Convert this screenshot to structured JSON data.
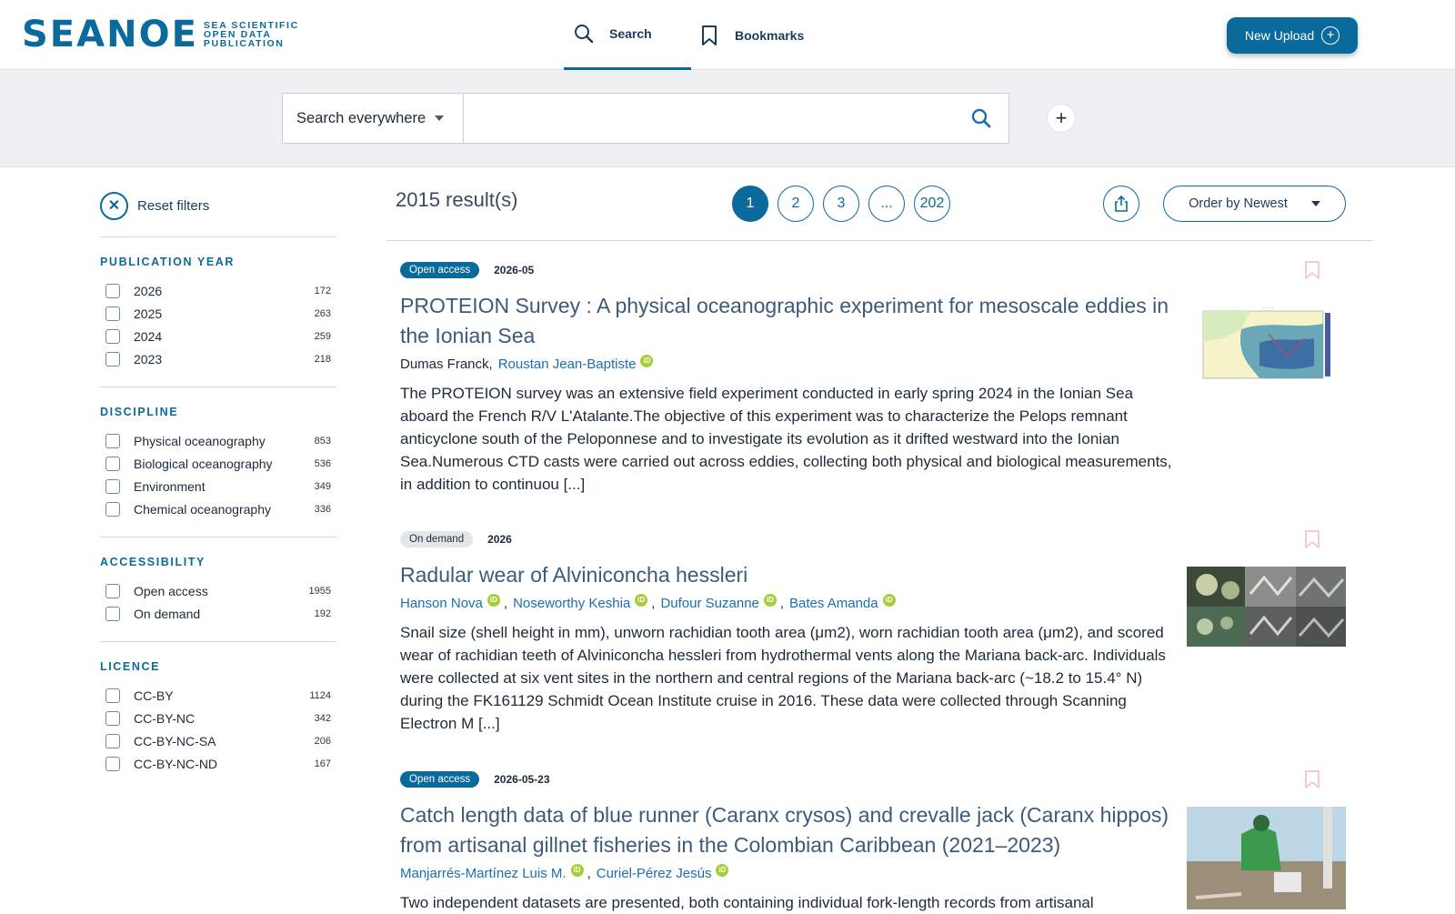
{
  "header": {
    "logo": {
      "word": "SEANOE",
      "sub1": "SEA SCIENTIFIC",
      "sub2": "OPEN DATA",
      "sub3": "PUBLICATION"
    },
    "nav": {
      "search": "Search",
      "bookmarks": "Bookmarks"
    },
    "upload": "New Upload"
  },
  "search": {
    "scope": "Search everywhere",
    "query": "",
    "add": "+"
  },
  "sidebar": {
    "reset": "Reset filters",
    "facets": [
      {
        "title": "PUBLICATION YEAR",
        "items": [
          {
            "label": "2026",
            "count": "172"
          },
          {
            "label": "2025",
            "count": "263"
          },
          {
            "label": "2024",
            "count": "259"
          },
          {
            "label": "2023",
            "count": "218"
          }
        ]
      },
      {
        "title": "DISCIPLINE",
        "items": [
          {
            "label": "Physical oceanography",
            "count": "853"
          },
          {
            "label": "Biological oceanography",
            "count": "536"
          },
          {
            "label": "Environment",
            "count": "349"
          },
          {
            "label": "Chemical oceanography",
            "count": "336"
          }
        ]
      },
      {
        "title": "ACCESSIBILITY",
        "items": [
          {
            "label": "Open access",
            "count": "1955"
          },
          {
            "label": "On demand",
            "count": "192"
          }
        ]
      },
      {
        "title": "LICENCE",
        "items": [
          {
            "label": "CC-BY",
            "count": "1124"
          },
          {
            "label": "CC-BY-NC",
            "count": "342"
          },
          {
            "label": "CC-BY-NC-SA",
            "count": "206"
          },
          {
            "label": "CC-BY-NC-ND",
            "count": "167"
          }
        ]
      }
    ]
  },
  "results": {
    "count": "2015 result(s)",
    "pages": [
      "1",
      "2",
      "3",
      "...",
      "202"
    ],
    "order": "Order by Newest",
    "items": [
      {
        "badge": "Open access",
        "date": "2026-05",
        "title": "PROTEION Survey : A physical oceanographic experiment for mesoscale eddies in the Ionian Sea",
        "author_plain": "Dumas  Franck",
        "author_links": [
          "Roustan Jean-Baptiste"
        ],
        "abstract": "The PROTEION survey was an extensive field experiment conducted in early spring 2024 in the Ionian Sea aboard the French R/V L'Atalante.The objective of this experiment was to characterize the Pelops remnant anticyclone south of the Peloponnese and to investigate its evolution as it drifted westward into the Ionian Sea.Numerous CTD casts were carried out across eddies, collecting both physical and biological measurements, in addition to continuou [...]"
      },
      {
        "badge": "On demand",
        "date": "2026",
        "title": "Radular wear of Alviniconcha hessleri",
        "author_links": [
          "Hanson Nova",
          "Noseworthy Keshia",
          "Dufour Suzanne",
          "Bates Amanda"
        ],
        "abstract": "Snail size (shell height in mm), unworn rachidian tooth area (μm2), worn rachidian tooth area (μm2), and scored wear of rachidian teeth of Alviniconcha hessleri from hydrothermal vents along the Mariana back-arc. Individuals were collected at six vent sites in the northern and central regions of the Mariana back-arc (~18.2 to 15.4° N) during the FK161129 Schmidt Ocean Institute cruise in 2016. These data were collected through Scanning Electron M [...]"
      },
      {
        "badge": "Open access",
        "date": "2026-05-23",
        "title": "Catch length data of blue runner (Caranx crysos) and crevalle jack (Caranx hippos) from artisanal gillnet fisheries in the Colombian Caribbean (2021–2023)",
        "author_links": [
          "Manjarrés-Martínez Luis M.",
          "Curiel-Pérez Jesús"
        ],
        "abstract": "Two independent datasets are presented, both containing individual fork-length records from artisanal"
      }
    ]
  },
  "orcid_text": "iD",
  "colors": {
    "primary": "#0b6a9c",
    "title": "#3d5a7a",
    "link": "#1a6fb0",
    "orcid": "#a6ce39"
  }
}
